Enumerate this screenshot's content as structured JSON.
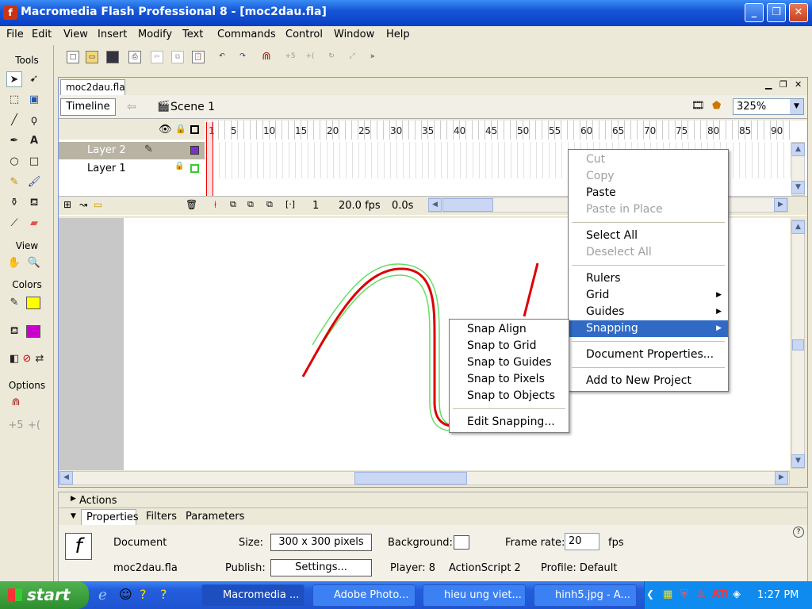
{
  "window": {
    "title": "Macromedia Flash Professional 8 - [moc2dau.fla]"
  },
  "menu": [
    "File",
    "Edit",
    "View",
    "Insert",
    "Modify",
    "Text",
    "Commands",
    "Control",
    "Window",
    "Help"
  ],
  "tools": {
    "title": "Tools",
    "view": "View",
    "colors": "Colors",
    "options": "Options",
    "stroke_color": "#FFFF00",
    "fill_color": "#CC00CC"
  },
  "document": {
    "tab": "moc2dau.fla",
    "timeline_btn": "Timeline",
    "scene": "Scene 1",
    "zoom": "325%"
  },
  "timeline": {
    "frame_labels": [
      "1",
      "5",
      "10",
      "15",
      "20",
      "25",
      "30",
      "35",
      "40",
      "45",
      "50",
      "55",
      "60",
      "65",
      "70",
      "75",
      "80",
      "85",
      "90"
    ],
    "layers": [
      {
        "name": "Layer 2",
        "color": "#7733CC"
      },
      {
        "name": "Layer 1",
        "color": "#33CC33"
      }
    ],
    "current_frame": "1",
    "fps": "20.0 fps",
    "time": "0.0s"
  },
  "context_menu": {
    "items": [
      "Cut",
      "Copy",
      "Paste",
      "Paste in Place",
      "Select All",
      "Deselect All",
      "Rulers",
      "Grid",
      "Guides",
      "Snapping",
      "Document Properties...",
      "Add to New Project"
    ]
  },
  "snap_menu": {
    "items": [
      "Snap Align",
      "Snap to Grid",
      "Snap to Guides",
      "Snap to Pixels",
      "Snap to Objects",
      "Edit Snapping..."
    ]
  },
  "panels": {
    "actions": "Actions",
    "tabs": [
      "Properties",
      "Filters",
      "Parameters"
    ]
  },
  "properties": {
    "type": "Document",
    "name": "moc2dau.fla",
    "size_label": "Size:",
    "size": "300 x 300 pixels",
    "background_label": "Background:",
    "frame_rate_label": "Frame rate:",
    "frame_rate": "20",
    "fps_unit": "fps",
    "publish_label": "Publish:",
    "settings": "Settings...",
    "player": "Player: 8",
    "actionscript": "ActionScript  2",
    "profile": "Profile:  Default"
  },
  "taskbar": {
    "start": "start",
    "tasks": [
      "Macromedia ...",
      "Adobe Photo...",
      "hieu ung viet...",
      "hinh5.jpg - A..."
    ],
    "clock": "1:27 PM"
  }
}
